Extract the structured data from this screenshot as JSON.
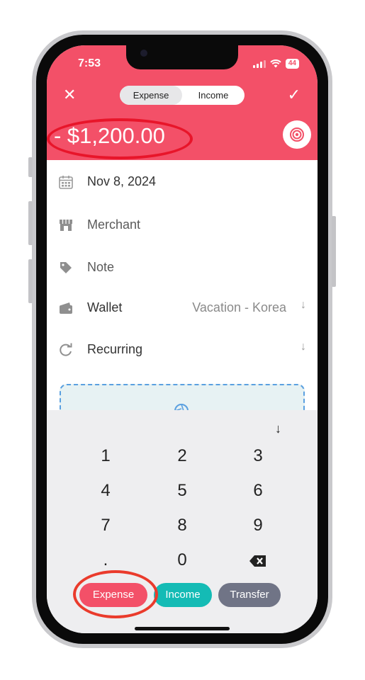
{
  "status_bar": {
    "time": "7:53",
    "battery": "44"
  },
  "header": {
    "segment": {
      "options": [
        "Expense",
        "Income"
      ],
      "selected": "Expense"
    },
    "amount": "- $1,200.00",
    "colors": {
      "header_bg": "#f35068",
      "annotation_ring": "#e8152a"
    }
  },
  "form": {
    "date": "Nov 8, 2024",
    "merchant_placeholder": "Merchant",
    "note_placeholder": "Note",
    "wallet_label": "Wallet",
    "wallet_value": "Vacation - Korea",
    "recurring_label": "Recurring"
  },
  "keypad": {
    "keys": [
      "1",
      "2",
      "3",
      "4",
      "5",
      "6",
      "7",
      "8",
      "9",
      ".",
      "0"
    ],
    "type_buttons": [
      {
        "label": "Expense",
        "color": "#f35068"
      },
      {
        "label": "Income",
        "color": "#14bbb5"
      },
      {
        "label": "Transfer",
        "color": "#707486"
      }
    ]
  }
}
